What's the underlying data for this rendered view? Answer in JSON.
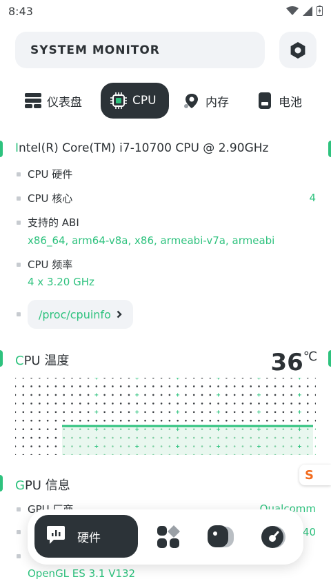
{
  "status": {
    "time": "8:43"
  },
  "header": {
    "title": "SYSTEM MONITOR"
  },
  "tabs": [
    {
      "label": "仪表盘",
      "icon": "dashboard-icon"
    },
    {
      "label": "CPU",
      "icon": "cpu-chip-icon"
    },
    {
      "label": "内存",
      "icon": "memory-pin-icon"
    },
    {
      "label": "电池",
      "icon": "battery-icon"
    }
  ],
  "cpu": {
    "model_first": "I",
    "model_rest": "ntel(R) Core(TM) i7-10700 CPU @ 2.90GHz",
    "hardware_label": "CPU 硬件",
    "cores_label": "CPU 核心",
    "cores_value": "4",
    "abi_label": "支持的 ABI",
    "abi_value": "x86_64, arm64-v8a, x86, armeabi-v7a, armeabi",
    "freq_label": "CPU 频率",
    "freq_value": "4 x 3.20 GHz",
    "cpuinfo_link": "/proc/cpuinfo"
  },
  "temp": {
    "title_first": "C",
    "title_rest": "PU 温度",
    "value": "36",
    "unit": "℃",
    "level": 36
  },
  "gpu": {
    "title_first": "G",
    "title_rest": "PU 信息",
    "vendor_label": "GPU 厂商",
    "vendor_value": "Qualcomm",
    "renderer_value_partial": "40",
    "opengl_value": "OpenGL ES 3.1 V132"
  },
  "bottom_nav": {
    "active_label": "硬件"
  },
  "colors": {
    "accent": "#2ec27e",
    "dark": "#2c3338",
    "pill_bg": "#f1f3f6"
  }
}
